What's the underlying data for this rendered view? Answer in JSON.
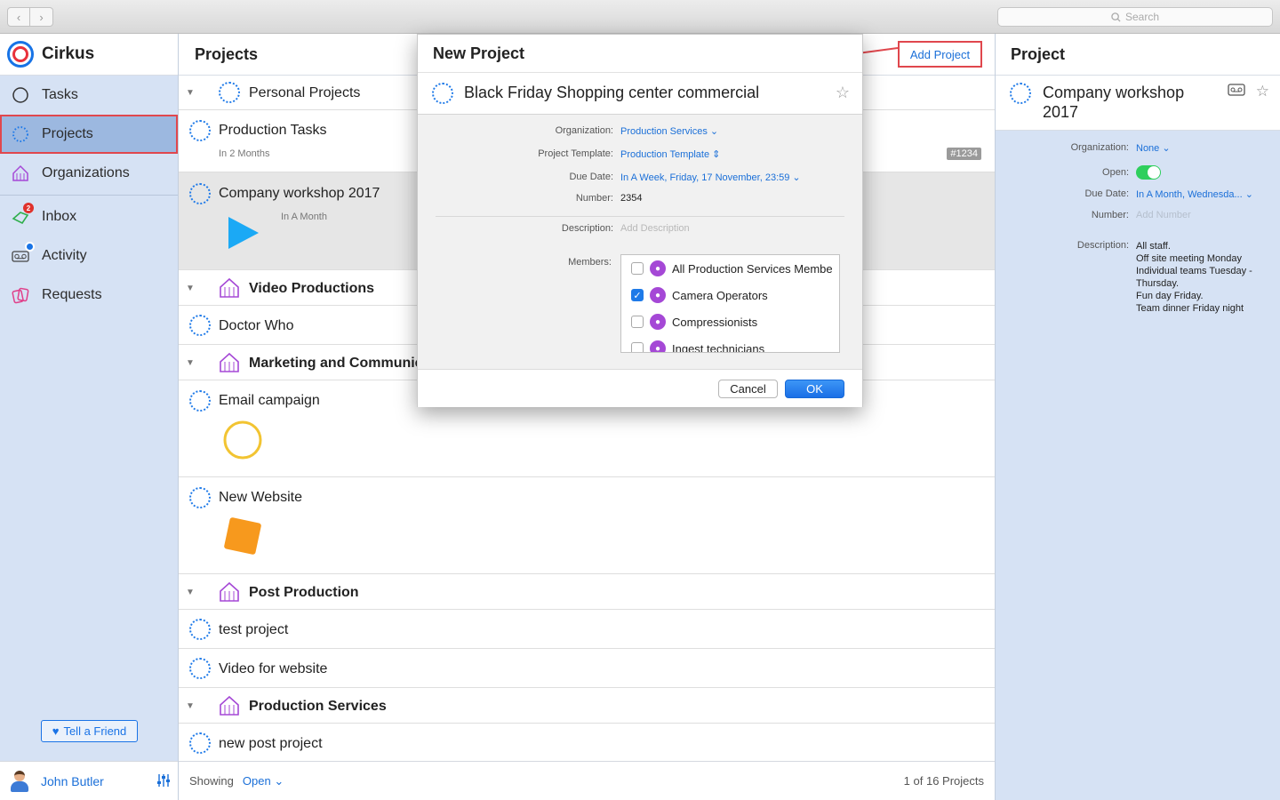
{
  "toolbar": {
    "back_glyph": "‹",
    "forward_glyph": "›",
    "search_placeholder": "Search"
  },
  "app": {
    "name": "Cirkus"
  },
  "sidebar": {
    "items": [
      {
        "label": "Tasks",
        "icon": "circle-icon"
      },
      {
        "label": "Projects",
        "icon": "dotted-circle-icon"
      },
      {
        "label": "Organizations",
        "icon": "tent-icon"
      },
      {
        "label": "Inbox",
        "icon": "inbox-icon",
        "badge": "2"
      },
      {
        "label": "Activity",
        "icon": "voicemail-icon"
      },
      {
        "label": "Requests",
        "icon": "cards-icon"
      }
    ],
    "tell_friend": "Tell a Friend",
    "user_name": "John Butler"
  },
  "projects": {
    "title": "Projects",
    "add_button": "Add Project",
    "rows": {
      "personal": "Personal Projects",
      "production_tasks": "Production Tasks",
      "production_tasks_due": "In 2 Months",
      "production_tasks_tag": "#1234",
      "workshop": "Company workshop 2017",
      "workshop_due": "In A Month",
      "video": "Video Productions",
      "doctor": "Doctor Who",
      "marketing": "Marketing and Communic",
      "email": "Email campaign",
      "website": "New Website",
      "post": "Post Production",
      "test": "test project",
      "video_site": "Video for website",
      "services": "Production Services",
      "new_post": "new post project"
    },
    "footer": {
      "showing": "Showing",
      "filter": "Open",
      "count": "1 of 16 Projects"
    }
  },
  "modal": {
    "title": "New Project",
    "name_value": "Black Friday Shopping center commercial",
    "labels": {
      "organization": "Organization:",
      "template": "Project Template:",
      "due": "Due Date:",
      "number": "Number:",
      "description": "Description:",
      "members": "Members:"
    },
    "values": {
      "organization": "Production Services",
      "template": "Production Template",
      "due": "In A Week, Friday, 17 November, 23:59",
      "number": "2354",
      "description_placeholder": "Add Description"
    },
    "members": [
      {
        "label": "All Production Services Membe",
        "checked": false
      },
      {
        "label": "Camera Operators",
        "checked": true
      },
      {
        "label": "Compressionists",
        "checked": false
      },
      {
        "label": "Ingest technicians",
        "checked": false
      }
    ],
    "cancel": "Cancel",
    "ok": "OK"
  },
  "detail": {
    "header": "Project",
    "title": "Company workshop 2017",
    "labels": {
      "organization": "Organization:",
      "open": "Open:",
      "due": "Due Date:",
      "number": "Number:",
      "description": "Description:"
    },
    "organization": "None",
    "open": true,
    "due": "In A Month, Wednesda...",
    "number_placeholder": "Add Number",
    "description_lines": [
      "All staff.",
      "Off site meeting Monday",
      "Individual teams Tuesday - Thursday.",
      "Fun day Friday.",
      "Team dinner Friday night"
    ]
  },
  "colors": {
    "accent": "#1a6fd8",
    "sidebar_bg": "#d6e2f4",
    "highlight": "#e0474d",
    "group_icon": "#a548d6"
  }
}
